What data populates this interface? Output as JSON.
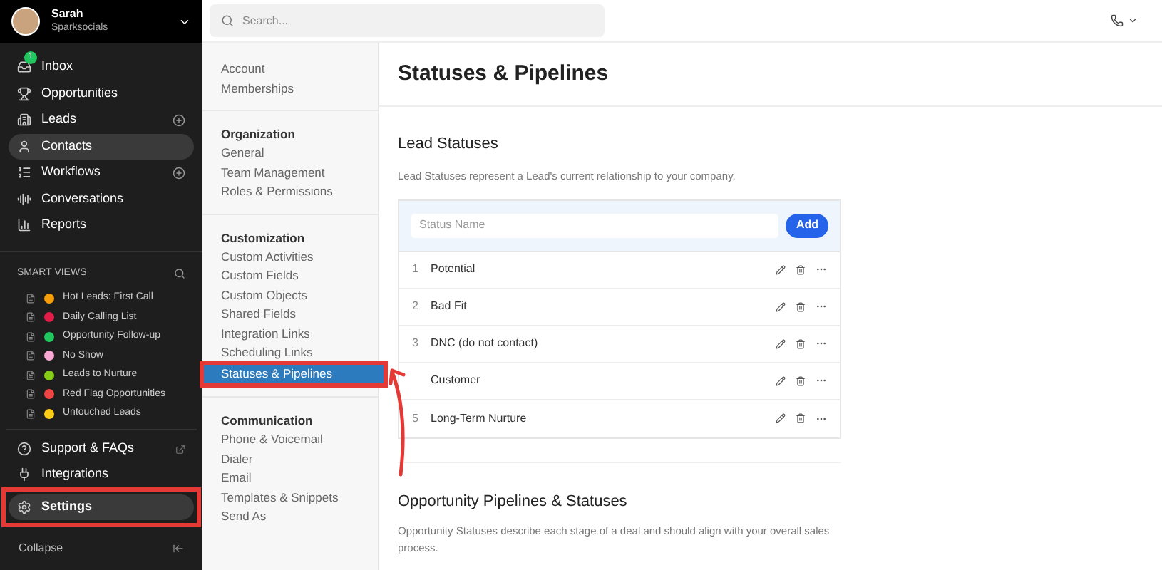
{
  "user": {
    "name": "Sarah",
    "org": "Sparksocials"
  },
  "nav": [
    {
      "label": "Inbox",
      "badge": "1",
      "plus": false,
      "selected": false
    },
    {
      "label": "Opportunities",
      "plus": false,
      "selected": false
    },
    {
      "label": "Leads",
      "plus": true,
      "selected": false
    },
    {
      "label": "Contacts",
      "plus": false,
      "selected": true
    },
    {
      "label": "Workflows",
      "plus": true,
      "selected": false
    },
    {
      "label": "Conversations",
      "plus": false,
      "selected": false
    },
    {
      "label": "Reports",
      "plus": false,
      "selected": false
    }
  ],
  "smart_views": {
    "title": "SMART VIEWS",
    "items": [
      {
        "label": "Hot Leads: First Call",
        "color": "#f59e0b"
      },
      {
        "label": "Daily Calling List",
        "color": "#e11d48"
      },
      {
        "label": "Opportunity Follow-up",
        "color": "#22c55e"
      },
      {
        "label": "No Show",
        "color": "#f9a8d4"
      },
      {
        "label": "Leads to Nurture",
        "color": "#84cc16"
      },
      {
        "label": "Red Flag Opportunities",
        "color": "#ef4444"
      },
      {
        "label": "Untouched Leads",
        "color": "#facc15"
      }
    ]
  },
  "bottom_nav": [
    {
      "label": "Support & FAQs",
      "external": true,
      "selected": false
    },
    {
      "label": "Integrations",
      "external": false,
      "selected": false
    },
    {
      "label": "Settings",
      "external": false,
      "selected": true
    }
  ],
  "collapse": "Collapse",
  "search": {
    "placeholder": "Search..."
  },
  "settings_nav": [
    {
      "items": [
        {
          "label": "Account",
          "selected": false
        },
        {
          "label": "Memberships",
          "selected": false
        }
      ]
    },
    {
      "heading": "Organization",
      "items": [
        {
          "label": "General",
          "selected": false
        },
        {
          "label": "Team Management",
          "selected": false
        },
        {
          "label": "Roles & Permissions",
          "selected": false
        }
      ]
    },
    {
      "heading": "Customization",
      "items": [
        {
          "label": "Custom Activities",
          "selected": false
        },
        {
          "label": "Custom Fields",
          "selected": false
        },
        {
          "label": "Custom Objects",
          "selected": false
        },
        {
          "label": "Shared Fields",
          "selected": false
        },
        {
          "label": "Integration Links",
          "selected": false
        },
        {
          "label": "Scheduling Links",
          "selected": false
        },
        {
          "label": "Statuses & Pipelines",
          "selected": true
        }
      ]
    },
    {
      "heading": "Communication",
      "items": [
        {
          "label": "Phone & Voicemail",
          "selected": false
        },
        {
          "label": "Dialer",
          "selected": false
        },
        {
          "label": "Email",
          "selected": false
        },
        {
          "label": "Templates & Snippets",
          "selected": false
        },
        {
          "label": "Send As",
          "selected": false
        }
      ]
    }
  ],
  "page_title": "Statuses & Pipelines",
  "lead_statuses": {
    "title": "Lead Statuses",
    "description": "Lead Statuses represent a Lead's current relationship to your company.",
    "input_placeholder": "Status Name",
    "add_button": "Add",
    "rows": [
      {
        "number": "1",
        "name": "Potential"
      },
      {
        "number": "2",
        "name": "Bad Fit"
      },
      {
        "number": "3",
        "name": "DNC (do not contact)"
      },
      {
        "number": null,
        "name": "Customer"
      },
      {
        "number": "5",
        "name": "Long-Term Nurture"
      }
    ]
  },
  "opportunity": {
    "title": "Opportunity Pipelines & Statuses",
    "description": "Opportunity Statuses describe each stage of a deal and should align with your overall sales process."
  }
}
